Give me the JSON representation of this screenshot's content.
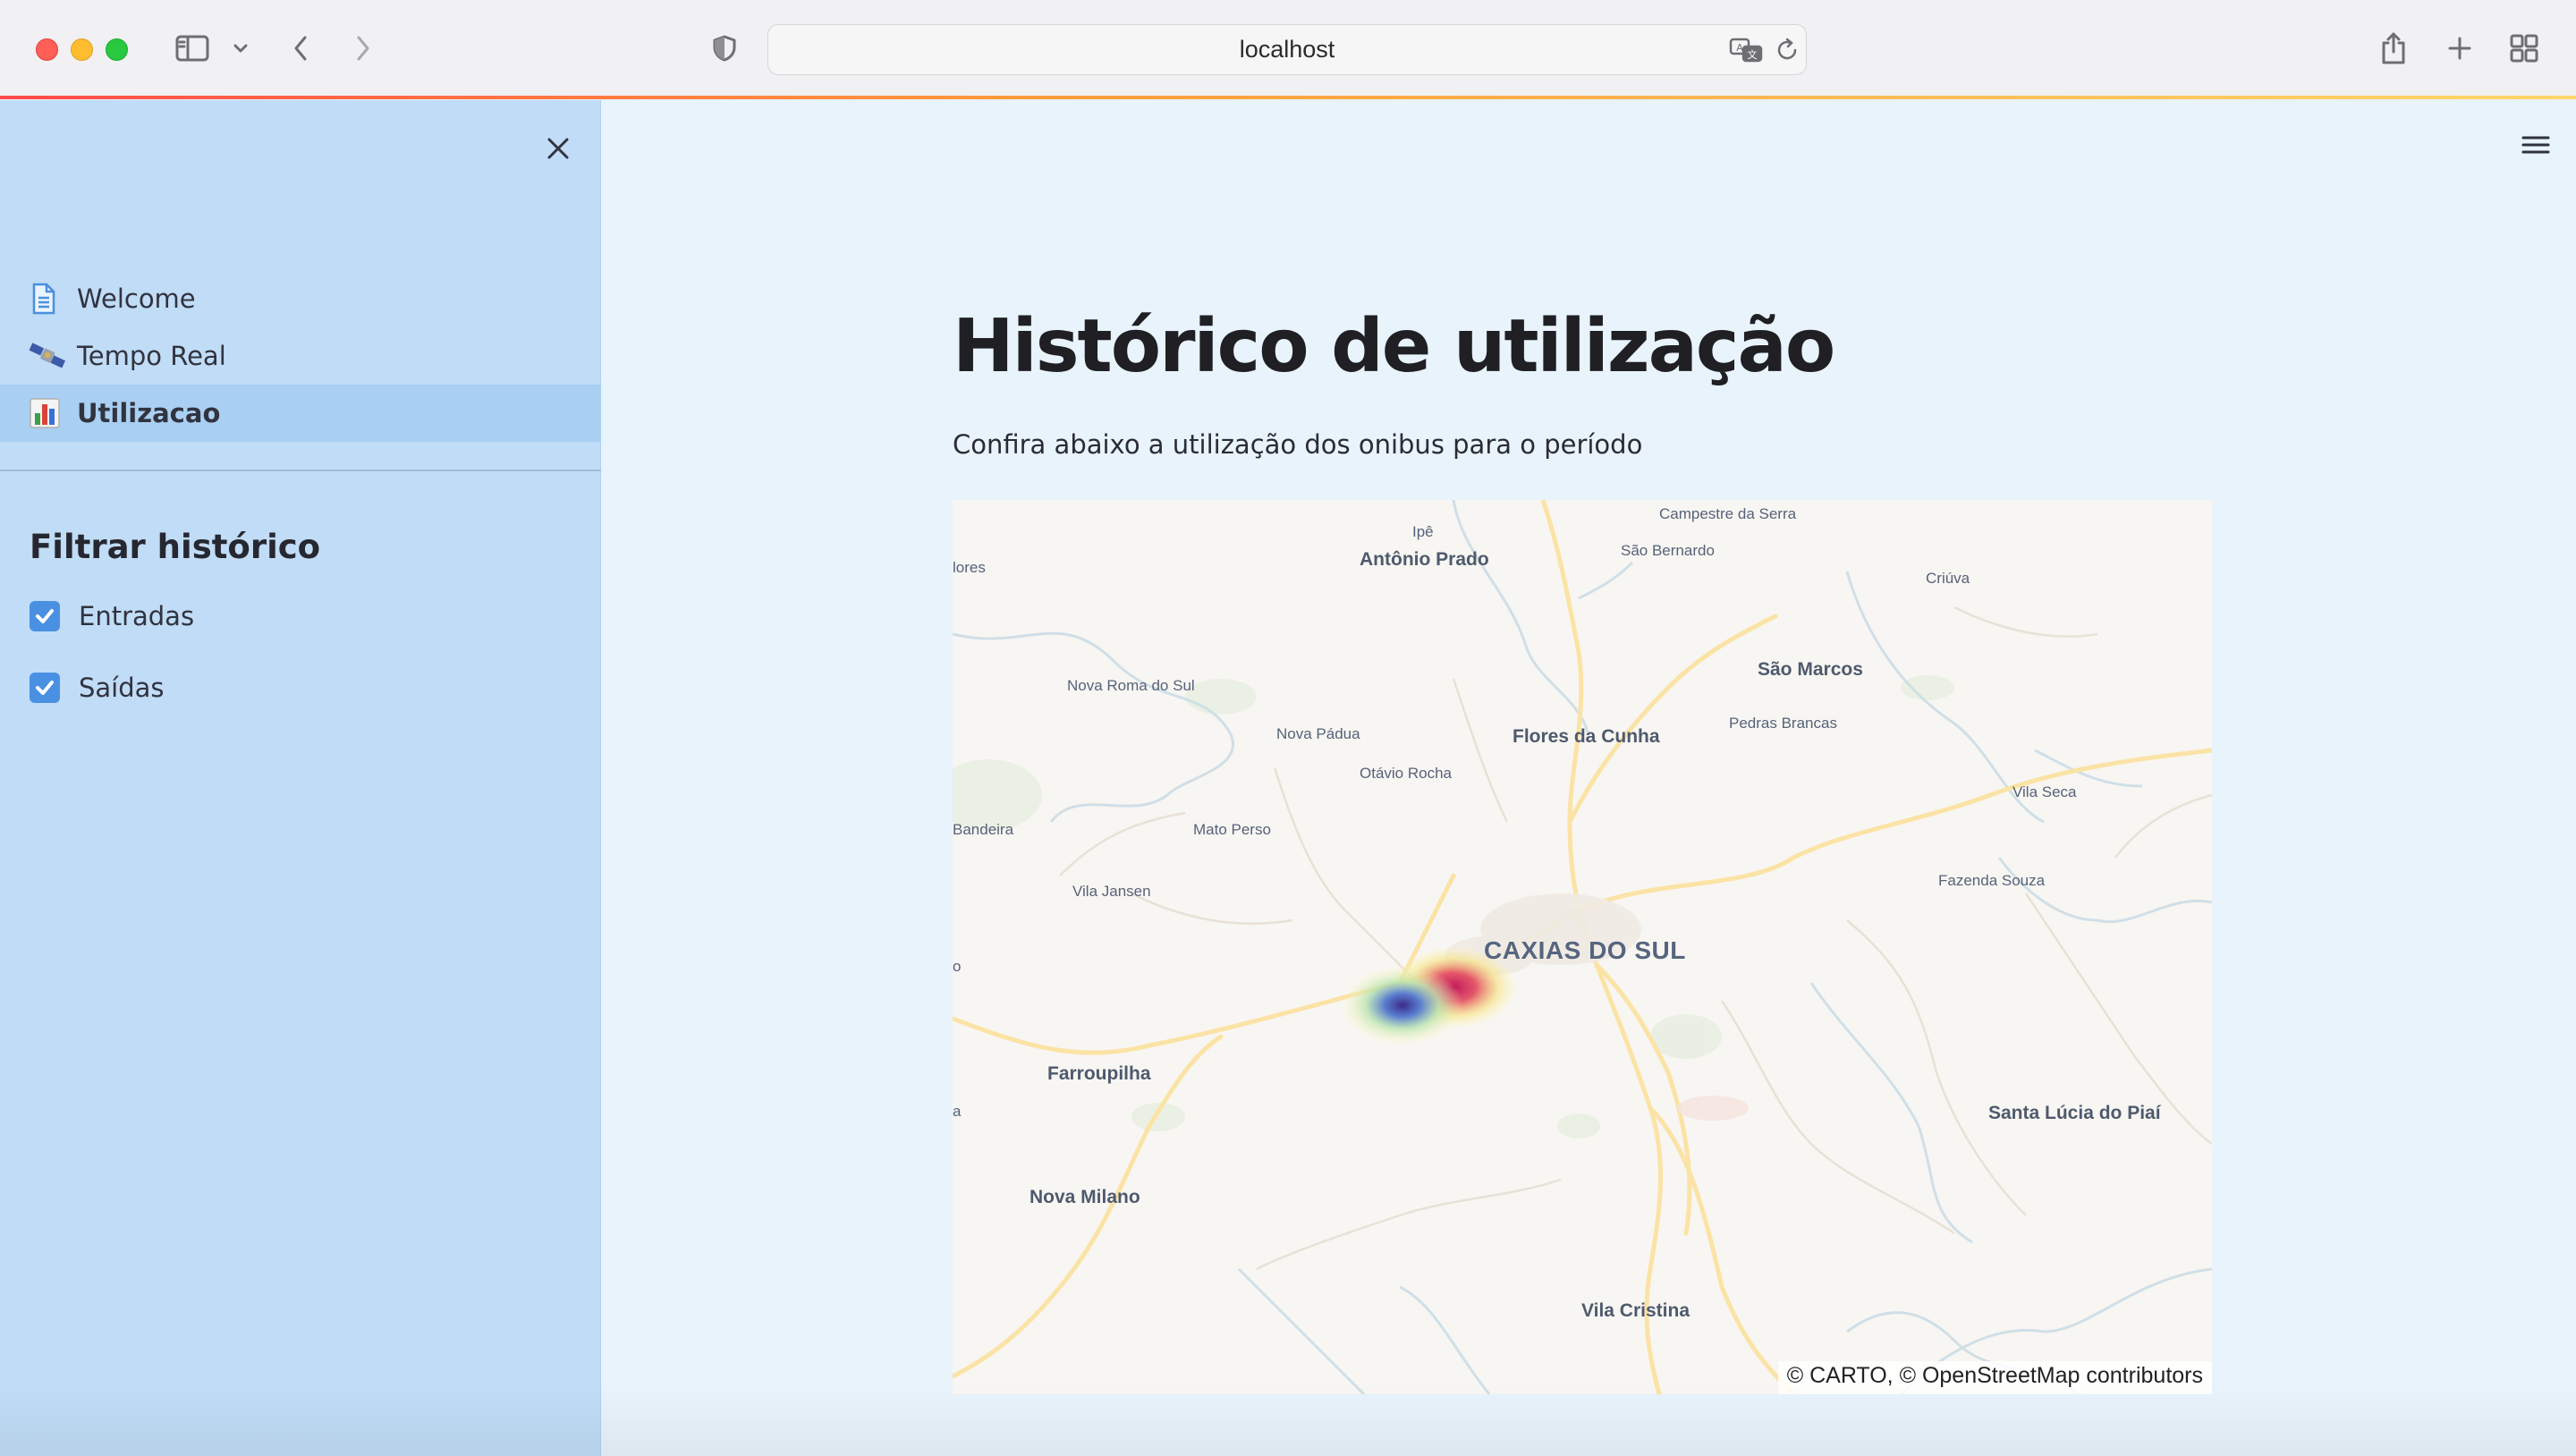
{
  "browser": {
    "url": "localhost",
    "icons": [
      "sidebar-toggle-icon",
      "chevron-down-icon",
      "back-icon",
      "forward-icon",
      "shield-icon",
      "translate-icon",
      "reload-icon",
      "share-icon",
      "new-tab-icon",
      "tab-overview-icon"
    ]
  },
  "sidebar": {
    "nav": [
      {
        "label": "Welcome",
        "icon": "page-icon"
      },
      {
        "label": "Tempo Real",
        "icon": "satellite-icon"
      },
      {
        "label": "Utilizacao",
        "icon": "bar-chart-icon",
        "active": true
      }
    ],
    "filter_title": "Filtrar histórico",
    "filters": [
      {
        "label": "Entradas",
        "checked": true
      },
      {
        "label": "Saídas",
        "checked": true
      }
    ]
  },
  "main": {
    "title": "Histórico de utilização",
    "subtitle": "Confira abaixo a utilização dos onibus para o período",
    "map": {
      "attribution": "© CARTO, © OpenStreetMap contributors",
      "places": [
        "Ipê",
        "Campestre da Serra",
        "Antônio Prado",
        "São Bernardo",
        "lores",
        "Criúva",
        "São Marcos",
        "Nova Roma do Sul",
        "Pedras Brancas",
        "Nova Pádua",
        "Flores da Cunha",
        "Otávio Rocha",
        "Vila Seca",
        "Bandeira",
        "Mato Perso",
        "Fazenda Souza",
        "Vila Jansen",
        "CAXIAS DO SUL",
        "o",
        "Farroupilha",
        "a",
        "Santa Lúcia do Piaí",
        "Nova Milano",
        "Vila Cristina"
      ]
    }
  }
}
